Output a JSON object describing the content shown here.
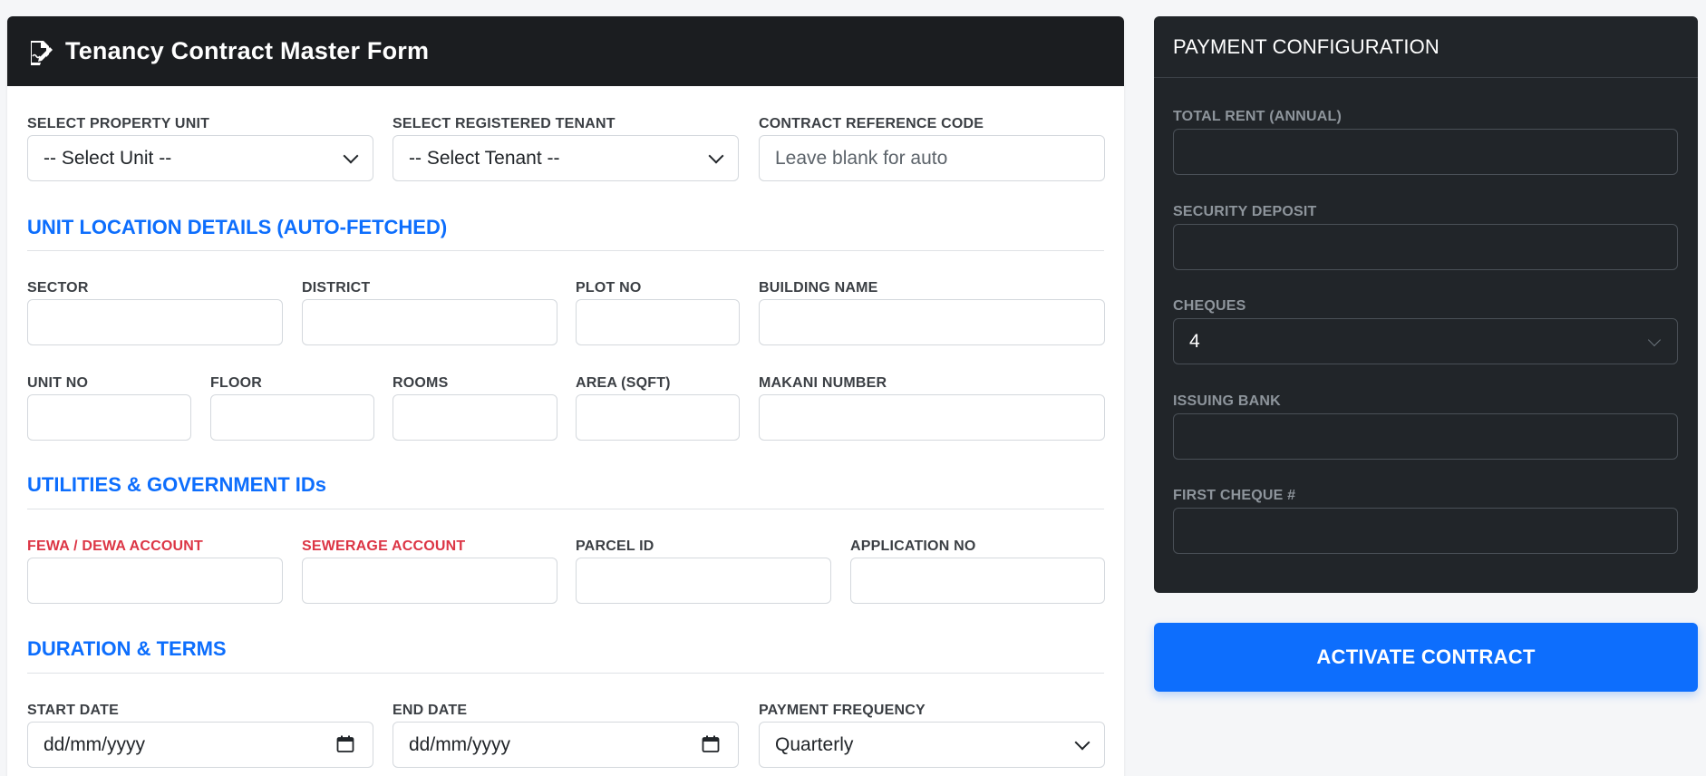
{
  "header": {
    "title": "Tenancy Contract Master Form"
  },
  "top_row": {
    "unit_label": "SELECT PROPERTY UNIT",
    "unit_value": "-- Select Unit --",
    "tenant_label": "SELECT REGISTERED TENANT",
    "tenant_value": "-- Select Tenant --",
    "ref_label": "CONTRACT REFERENCE CODE",
    "ref_placeholder": "Leave blank for auto"
  },
  "unit_location": {
    "title": "UNIT LOCATION DETAILS (AUTO-FETCHED)",
    "sector_label": "SECTOR",
    "district_label": "DISTRICT",
    "plot_label": "PLOT NO",
    "building_label": "BUILDING NAME",
    "unit_no_label": "UNIT NO",
    "floor_label": "FLOOR",
    "rooms_label": "ROOMS",
    "area_label": "AREA (SQFT)",
    "makani_label": "MAKANI NUMBER"
  },
  "utilities": {
    "title": "UTILITIES & GOVERNMENT IDs",
    "fewa_label": "FEWA / DEWA ACCOUNT",
    "sewerage_label": "SEWERAGE ACCOUNT",
    "parcel_label": "PARCEL ID",
    "application_label": "APPLICATION NO"
  },
  "duration": {
    "title": "DURATION & TERMS",
    "start_label": "START DATE",
    "start_placeholder": "dd/mm/yyyy",
    "end_label": "END DATE",
    "end_placeholder": "dd/mm/yyyy",
    "frequency_label": "PAYMENT FREQUENCY",
    "frequency_value": "Quarterly"
  },
  "payment": {
    "title": "PAYMENT CONFIGURATION",
    "total_rent_label": "TOTAL RENT (ANNUAL)",
    "deposit_label": "SECURITY DEPOSIT",
    "cheques_label": "CHEQUES",
    "cheques_value": "4",
    "bank_label": "ISSUING BANK",
    "first_cheque_label": "FIRST CHEQUE #"
  },
  "actions": {
    "activate_label": "ACTIVATE CONTRACT"
  },
  "colors": {
    "accent": "#0d6efd",
    "header_bg": "#1b1d20",
    "side_bg": "#212529",
    "required": "#dc3545"
  }
}
